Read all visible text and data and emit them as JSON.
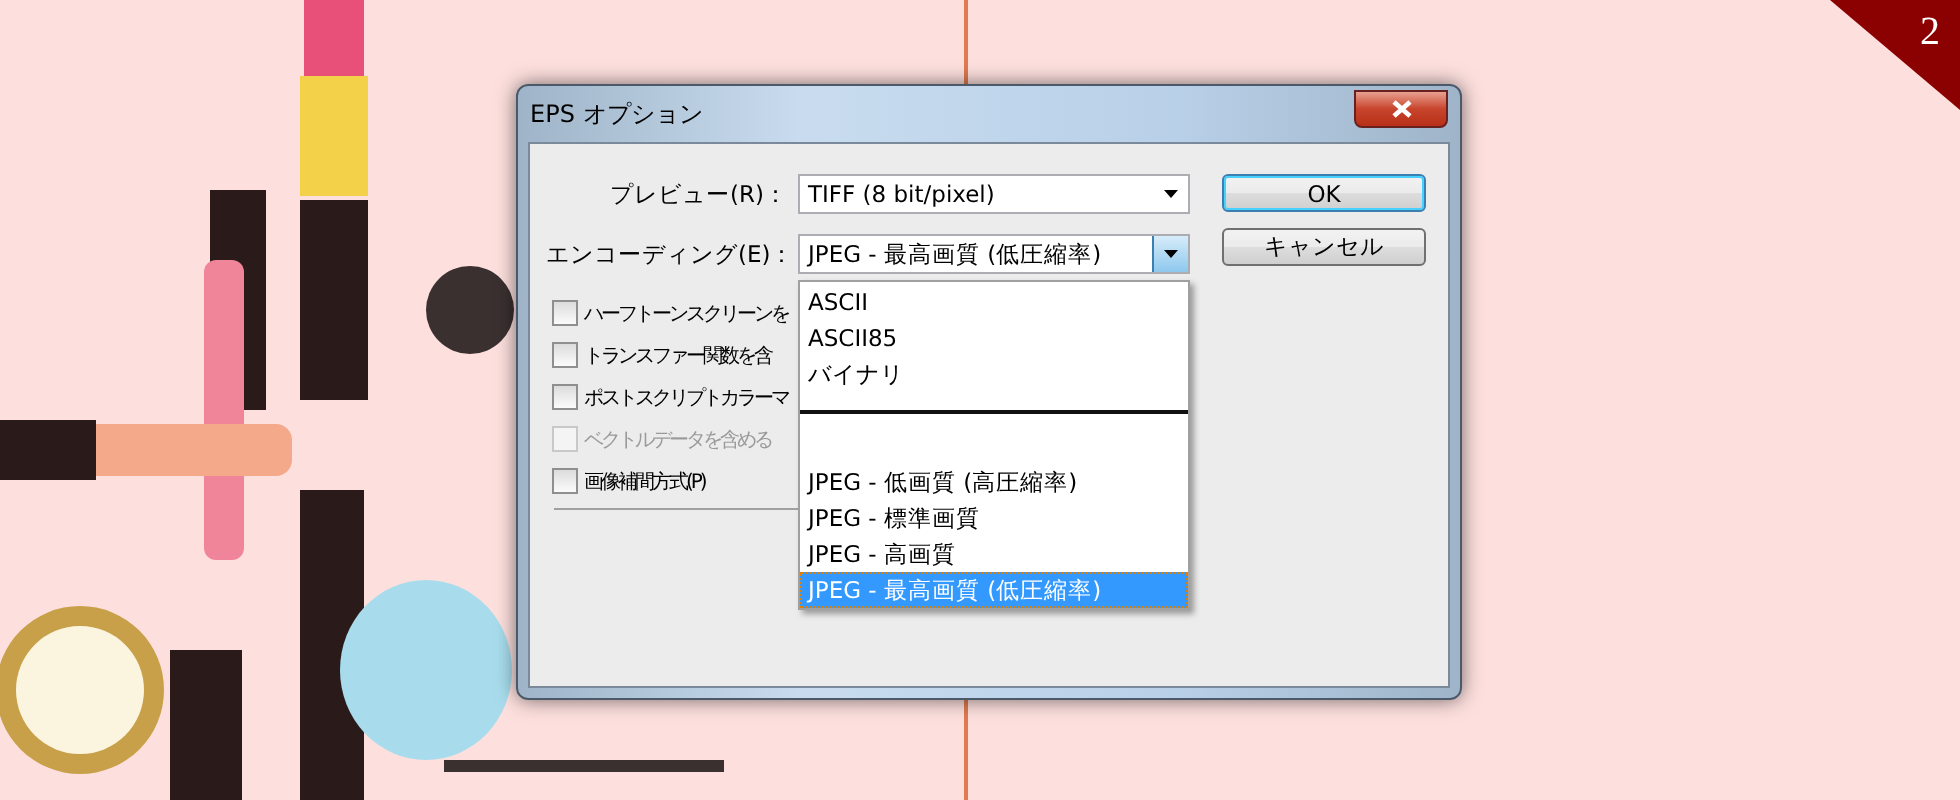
{
  "window": {
    "title": "EPS オプション"
  },
  "preview": {
    "label": "プレビュー(R)：",
    "value": "TIFF (8 bit/pixel)"
  },
  "encoding": {
    "label": "エンコーディング(E)：",
    "value": "JPEG - 最高画質 (低圧縮率)",
    "expanded": true
  },
  "buttons": [
    {
      "label": "OK",
      "default": true
    },
    {
      "label": "キャンセル",
      "default": false
    }
  ],
  "checkboxes": [
    {
      "label": "ハーフトーンスクリーンを",
      "checked": false,
      "disabled": false
    },
    {
      "label": "トランスファー関数を含",
      "checked": false,
      "disabled": false
    },
    {
      "label": "ポストスクリプトカラーマ",
      "checked": false,
      "disabled": false
    },
    {
      "label": "ベクトルデータを含める",
      "checked": false,
      "disabled": true
    },
    {
      "label": "画像補間方式(P)",
      "checked": false,
      "disabled": false
    }
  ],
  "dropdown": {
    "options": [
      {
        "kind": "option",
        "label": "ASCII",
        "selected": false
      },
      {
        "kind": "option",
        "label": "ASCII85",
        "selected": false
      },
      {
        "kind": "option",
        "label": "バイナリ",
        "selected": false
      },
      {
        "kind": "separator"
      },
      {
        "kind": "option",
        "label": "JPEG - 低画質 (高圧縮率)",
        "selected": false
      },
      {
        "kind": "option",
        "label": "JPEG - 標準画質",
        "selected": false
      },
      {
        "kind": "option",
        "label": "JPEG - 高画質",
        "selected": false
      },
      {
        "kind": "option",
        "label": "JPEG - 最高画質 (低圧縮率)",
        "selected": true
      }
    ]
  },
  "page_badge": "2"
}
